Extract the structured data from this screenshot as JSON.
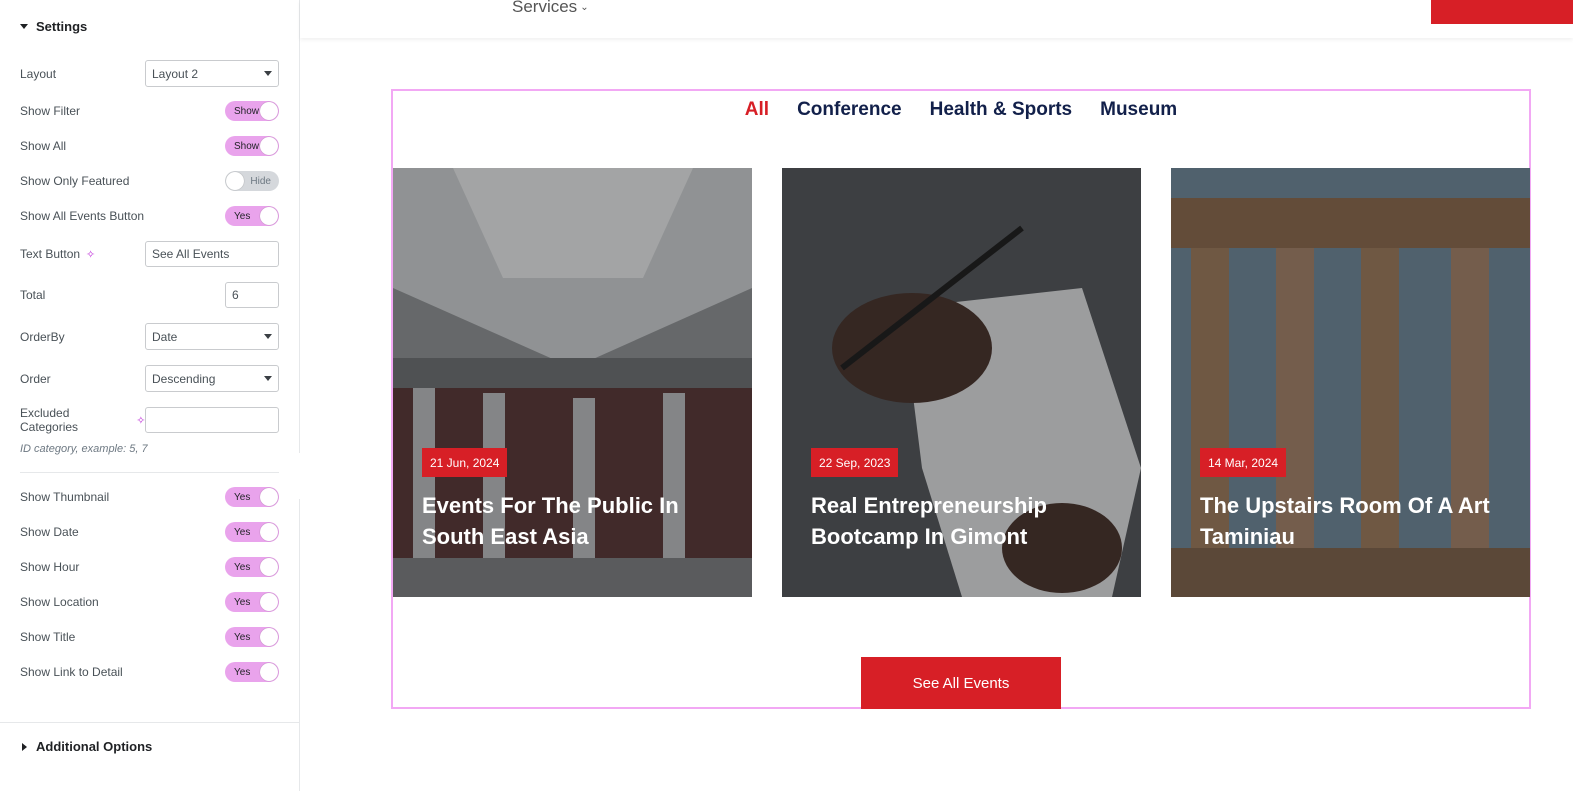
{
  "panel": {
    "settings_title": "Settings",
    "additional_title": "Additional Options",
    "layout": {
      "label": "Layout",
      "value": "Layout 2"
    },
    "show_filter": {
      "label": "Show Filter",
      "state": "Show"
    },
    "show_all": {
      "label": "Show All",
      "state": "Show"
    },
    "show_only_featured": {
      "label": "Show Only Featured",
      "state": "Hide"
    },
    "show_all_events_button": {
      "label": "Show All Events Button",
      "state": "Yes"
    },
    "text_button": {
      "label": "Text Button",
      "value": "See All Events"
    },
    "total": {
      "label": "Total",
      "value": "6"
    },
    "orderby": {
      "label": "OrderBy",
      "value": "Date"
    },
    "order": {
      "label": "Order",
      "value": "Descending"
    },
    "excluded_categories": {
      "label": "Excluded Categories",
      "value": ""
    },
    "excluded_hint": "ID category, example: 5, 7",
    "show_thumbnail": {
      "label": "Show Thumbnail",
      "state": "Yes"
    },
    "show_date": {
      "label": "Show Date",
      "state": "Yes"
    },
    "show_hour": {
      "label": "Show Hour",
      "state": "Yes"
    },
    "show_location": {
      "label": "Show Location",
      "state": "Yes"
    },
    "show_title": {
      "label": "Show Title",
      "state": "Yes"
    },
    "show_link_to_detail": {
      "label": "Show Link to Detail",
      "state": "Yes"
    }
  },
  "site": {
    "nav_services": "Services"
  },
  "widget": {
    "filters": [
      "All",
      "Conference",
      "Health & Sports",
      "Museum"
    ],
    "cards": [
      {
        "date": "21 Jun, 2024",
        "title": "Events For The Public In South East Asia"
      },
      {
        "date": "22 Sep, 2023",
        "title": "Real Entrepreneurship Bootcamp In Gimont"
      },
      {
        "date": "14 Mar, 2024",
        "title": "The Upstairs Room Of A Art Taminiau"
      }
    ],
    "button": "See All Events"
  },
  "colors": {
    "accent": "#d71f26",
    "navy": "#12204a",
    "toggle_on": "#e9a3ec",
    "widget_outline": "#f2a8f4"
  }
}
